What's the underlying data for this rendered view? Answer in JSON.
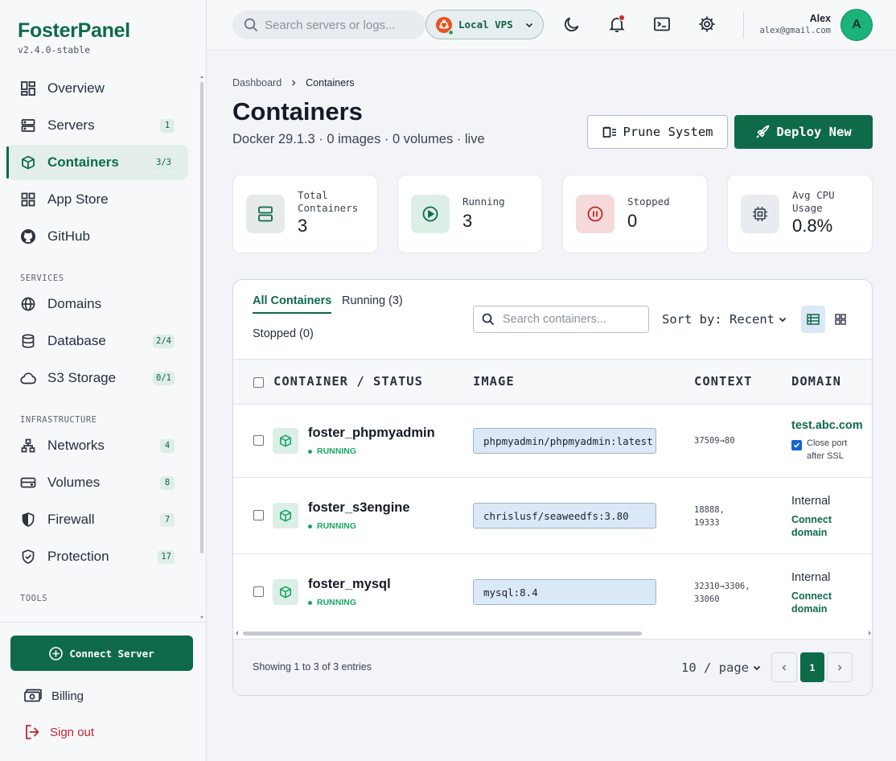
{
  "brand": {
    "name": "FosterPanel",
    "version": "v2.4.0-stable"
  },
  "sidebar": {
    "main": [
      {
        "label": "Overview",
        "badge": ""
      },
      {
        "label": "Servers",
        "badge": "1"
      },
      {
        "label": "Containers",
        "badge": "3/3"
      },
      {
        "label": "App Store",
        "badge": ""
      },
      {
        "label": "GitHub",
        "badge": ""
      }
    ],
    "sections": {
      "services": "SERVICES",
      "infrastructure": "INFRASTRUCTURE",
      "tools": "TOOLS"
    },
    "services": [
      {
        "label": "Domains",
        "badge": ""
      },
      {
        "label": "Database",
        "badge": "2/4"
      },
      {
        "label": "S3 Storage",
        "badge": "0/1"
      }
    ],
    "infrastructure": [
      {
        "label": "Networks",
        "badge": "4"
      },
      {
        "label": "Volumes",
        "badge": "8"
      },
      {
        "label": "Firewall",
        "badge": "7"
      },
      {
        "label": "Protection",
        "badge": "17"
      }
    ],
    "connect_button": "Connect Server",
    "billing": "Billing",
    "signout": "Sign out"
  },
  "header": {
    "search_placeholder": "Search servers or logs...",
    "server": "Local VPS",
    "user_name": "Alex",
    "user_email": "alex@gmail.com",
    "avatar_letter": "A"
  },
  "page": {
    "breadcrumb": [
      "Dashboard",
      "Containers"
    ],
    "title": "Containers",
    "subtitle": "Docker 29.1.3 · 0 images · 0 volumes · live",
    "prune_label": "Prune System",
    "deploy_label": "Deploy New"
  },
  "stats": [
    {
      "label": "Total Containers",
      "value": "3"
    },
    {
      "label": "Running",
      "value": "3"
    },
    {
      "label": "Stopped",
      "value": "0"
    },
    {
      "label": "Avg CPU Usage",
      "value": "0.8%"
    }
  ],
  "table": {
    "tabs": [
      "All Containers",
      "Running (3)",
      "Stopped (0)"
    ],
    "search_placeholder": "Search containers...",
    "sort_label": "Sort by: Recent",
    "columns": [
      "CONTAINER / STATUS",
      "IMAGE",
      "CONTEXT",
      "DOMAIN"
    ],
    "rows": [
      {
        "name": "foster_phpmyadmin",
        "status": "RUNNING",
        "image": "phpmyadmin/phpmyadmin:latest",
        "context1": "37509→80",
        "context2": "",
        "domain": "test.abc.com",
        "close_port": "Close port after SSL"
      },
      {
        "name": "foster_s3engine",
        "status": "RUNNING",
        "image": "chrislusf/seaweedfs:3.80",
        "context1": "18888,",
        "context2": "19333",
        "internal": "Internal",
        "connect": "Connect domain"
      },
      {
        "name": "foster_mysql",
        "status": "RUNNING",
        "image": "mysql:8.4",
        "context1": "32310→3306,",
        "context2": "33060",
        "internal": "Internal",
        "connect": "Connect domain"
      }
    ],
    "footer_info": "Showing 1 to 3 of 3 entries",
    "per_page": "10 / page",
    "current_page": "1"
  },
  "colors": {
    "brand": "#0f6a4a",
    "running": "#1aa567",
    "danger": "#c0262d"
  }
}
